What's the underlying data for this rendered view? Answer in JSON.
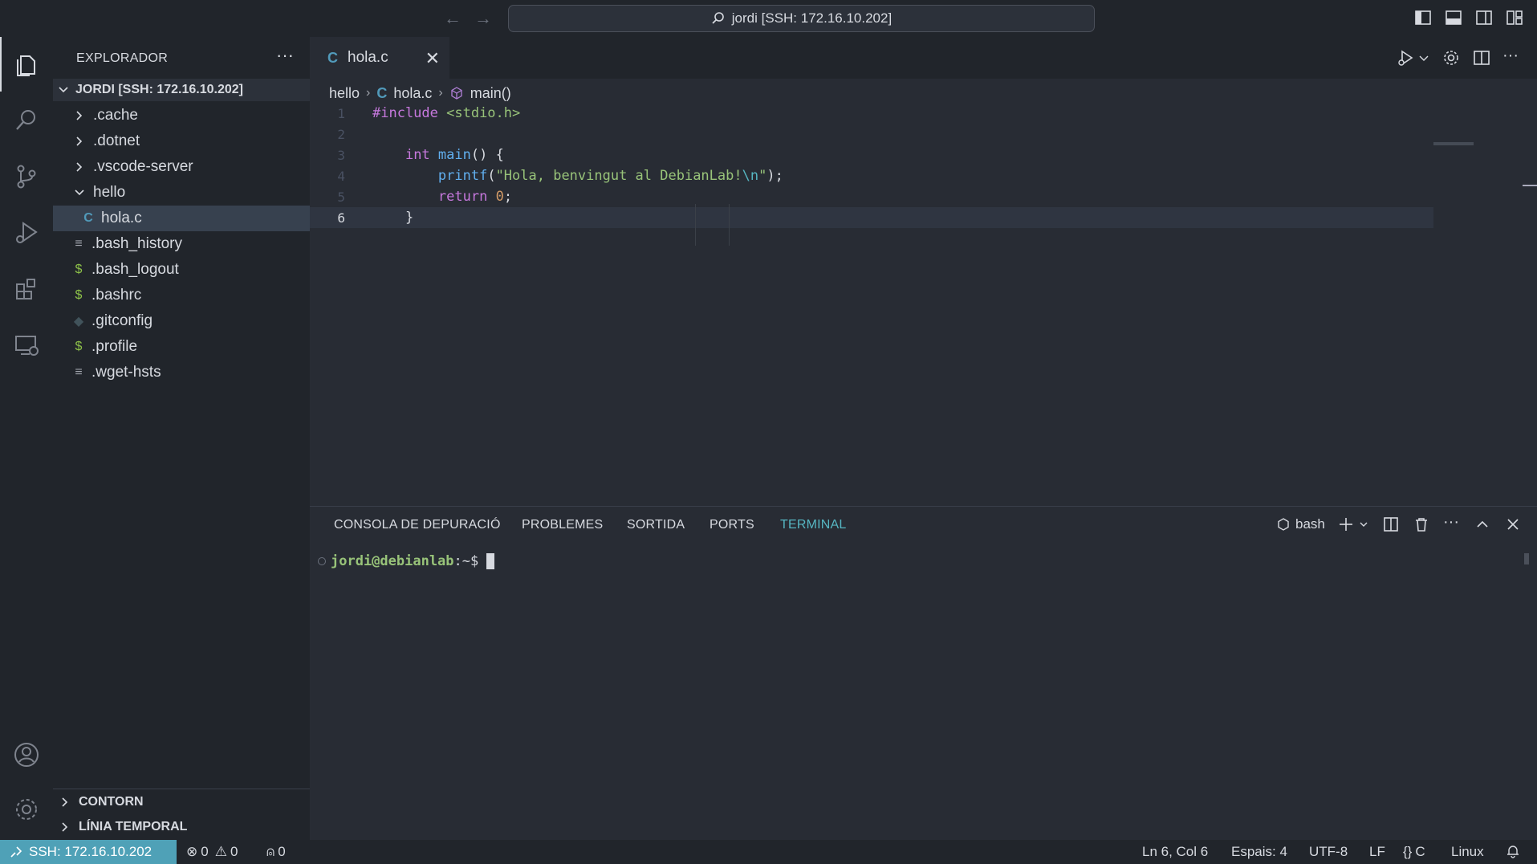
{
  "titlebar": {
    "back_icon": "arrow-left-icon",
    "forward_icon": "arrow-right-icon",
    "command_center": "jordi [SSH: 172.16.10.202]"
  },
  "activity_bar": {
    "items": [
      "explorer",
      "search",
      "source-control",
      "run-and-debug",
      "extensions",
      "remote-explorer"
    ],
    "bottom": [
      "accounts",
      "manage"
    ]
  },
  "sidebar": {
    "title": "EXPLORADOR",
    "root": "JORDI [SSH: 172.16.10.202]",
    "items": [
      {
        "label": ".cache",
        "kind": "folder",
        "icon": "chevron-right-icon"
      },
      {
        "label": ".dotnet",
        "kind": "folder",
        "icon": "chevron-right-icon"
      },
      {
        "label": ".vscode-server",
        "kind": "folder",
        "icon": "chevron-right-icon"
      },
      {
        "label": "hello",
        "kind": "folder-open",
        "icon": "chevron-down-icon"
      },
      {
        "label": "hola.c",
        "kind": "c-file",
        "icon": "C"
      },
      {
        "label": ".bash_history",
        "kind": "text",
        "icon": "≡"
      },
      {
        "label": ".bash_logout",
        "kind": "shell",
        "icon": "$"
      },
      {
        "label": ".bashrc",
        "kind": "shell",
        "icon": "$"
      },
      {
        "label": ".gitconfig",
        "kind": "git",
        "icon": "◆"
      },
      {
        "label": ".profile",
        "kind": "shell",
        "icon": "$"
      },
      {
        "label": ".wget-hsts",
        "kind": "text",
        "icon": "≡"
      }
    ],
    "outline": "CONTORN",
    "timeline": "LÍNIA TEMPORAL"
  },
  "editor": {
    "tab": {
      "label": "hola.c",
      "icon": "C"
    },
    "breadcrumb": {
      "folder": "hello",
      "file_icon": "C",
      "file": "hola.c",
      "symbol": "main()"
    },
    "lines": [
      {
        "n": "1",
        "tokens": [
          {
            "t": "#include ",
            "c": "inc"
          },
          {
            "t": "<stdio.h>",
            "c": "hdr"
          }
        ]
      },
      {
        "n": "2",
        "tokens": []
      },
      {
        "n": "3",
        "tokens": [
          {
            "t": "    ",
            "c": "punc"
          },
          {
            "t": "int",
            "c": "type"
          },
          {
            "t": " ",
            "c": "punc"
          },
          {
            "t": "main",
            "c": "fn"
          },
          {
            "t": "() {",
            "c": "punc"
          }
        ]
      },
      {
        "n": "4",
        "tokens": [
          {
            "t": "        ",
            "c": "punc"
          },
          {
            "t": "printf",
            "c": "fn"
          },
          {
            "t": "(",
            "c": "punc"
          },
          {
            "t": "\"Hola, benvingut al DebianLab!",
            "c": "str"
          },
          {
            "t": "\\n",
            "c": "esc"
          },
          {
            "t": "\"",
            "c": "str"
          },
          {
            "t": ");",
            "c": "punc"
          }
        ]
      },
      {
        "n": "5",
        "tokens": [
          {
            "t": "        ",
            "c": "punc"
          },
          {
            "t": "return",
            "c": "kw"
          },
          {
            "t": " ",
            "c": "punc"
          },
          {
            "t": "0",
            "c": "num"
          },
          {
            "t": ";",
            "c": "punc"
          }
        ]
      },
      {
        "n": "6",
        "tokens": [
          {
            "t": "    ",
            "c": "punc"
          },
          {
            "t": "}",
            "c": "punc"
          }
        ]
      }
    ],
    "current_line": "6"
  },
  "panel": {
    "tabs": [
      "CONSOLA DE DEPURACIÓ",
      "PROBLEMES",
      "SORTIDA",
      "PORTS",
      "TERMINAL"
    ],
    "active_tab": "TERMINAL",
    "terminal_name": "bash",
    "prompt_user": "jordi@debianlab",
    "prompt_path": ":~$"
  },
  "statusbar": {
    "remote": "SSH: 172.16.10.202",
    "errors": "0",
    "warnings": "0",
    "ports": "0",
    "position": "Ln 6, Col 6",
    "spaces": "Espais: 4",
    "encoding": "UTF-8",
    "eol": "LF",
    "language": "C",
    "os": "Linux"
  },
  "colors": {
    "accent": "#4fa1b7",
    "background": "#282c34",
    "sidebar": "#21252b",
    "string": "#98c379",
    "keyword": "#c678dd",
    "function": "#61afef"
  }
}
